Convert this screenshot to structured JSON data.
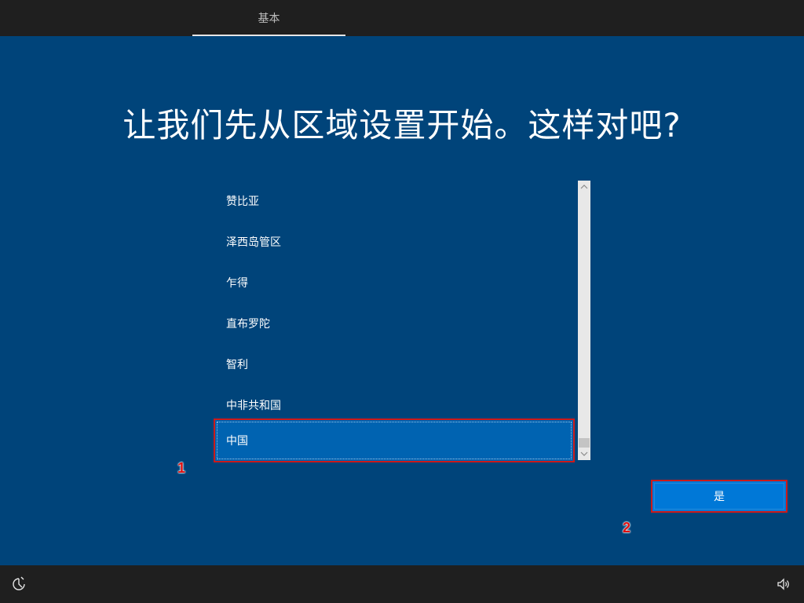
{
  "header": {
    "tab_label": "基本"
  },
  "main": {
    "title": "让我们先从区域设置开始。这样对吧?"
  },
  "region_list": {
    "items": [
      {
        "label": "赞比亚",
        "selected": false
      },
      {
        "label": "泽西岛管区",
        "selected": false
      },
      {
        "label": "乍得",
        "selected": false
      },
      {
        "label": "直布罗陀",
        "selected": false
      },
      {
        "label": "智利",
        "selected": false
      },
      {
        "label": "中非共和国",
        "selected": false
      },
      {
        "label": "中国",
        "selected": true
      }
    ]
  },
  "annotations": {
    "marker_1": "1",
    "marker_2": "2"
  },
  "actions": {
    "yes_label": "是"
  },
  "icons": {
    "bottom_left": "ease-of-access-icon",
    "bottom_right": "volume-icon",
    "scroll_up": "chevron-up-icon",
    "scroll_down": "chevron-down-icon"
  },
  "colors": {
    "background": "#00447a",
    "selected_item": "#0063b1",
    "primary_button": "#0078d7",
    "annotation": "#e01010"
  }
}
